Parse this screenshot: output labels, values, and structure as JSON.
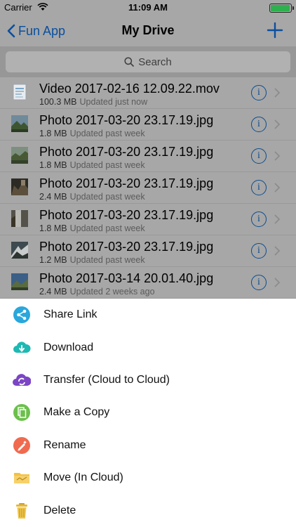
{
  "status_bar": {
    "carrier": "Carrier",
    "time": "11:09 AM",
    "battery_level": 0.95
  },
  "nav": {
    "back_label": "Fun App",
    "title": "My Drive"
  },
  "search": {
    "placeholder": "Search"
  },
  "files": [
    {
      "name": "Video 2017-02-16 12.09.22.mov",
      "size": "100.3 MB",
      "updated": "Updated just now",
      "type": "video"
    },
    {
      "name": "Photo 2017-03-20 23.17.19.jpg",
      "size": "1.8 MB",
      "updated": "Updated past week",
      "type": "photo"
    },
    {
      "name": "Photo 2017-03-20 23.17.19.jpg",
      "size": "1.8 MB",
      "updated": "Updated past week",
      "type": "photo"
    },
    {
      "name": "Photo 2017-03-20 23.17.19.jpg",
      "size": "2.4 MB",
      "updated": "Updated past week",
      "type": "photo"
    },
    {
      "name": "Photo 2017-03-20 23.17.19.jpg",
      "size": "1.8 MB",
      "updated": "Updated past week",
      "type": "photo"
    },
    {
      "name": "Photo 2017-03-20 23.17.19.jpg",
      "size": "1.2 MB",
      "updated": "Updated past week",
      "type": "photo"
    },
    {
      "name": "Photo 2017-03-14 20.01.40.jpg",
      "size": "2.4 MB",
      "updated": "Updated 2 weeks ago",
      "type": "photo"
    }
  ],
  "actions": [
    {
      "label": "Share Link",
      "icon": "share-icon",
      "color": "#2aa7dc"
    },
    {
      "label": "Download",
      "icon": "cloud-download-icon",
      "color": "#1db9b3"
    },
    {
      "label": "Transfer (Cloud to Cloud)",
      "icon": "cloud-transfer-icon",
      "color": "#7b45c4"
    },
    {
      "label": "Make a Copy",
      "icon": "copy-icon",
      "color": "#6bc04b"
    },
    {
      "label": "Rename",
      "icon": "rename-icon",
      "color": "#f06a4f"
    },
    {
      "label": "Move (In Cloud)",
      "icon": "folder-icon",
      "color": "#f2c242"
    },
    {
      "label": "Delete",
      "icon": "trash-icon",
      "color": "#e8b830"
    }
  ],
  "colors": {
    "tint": "#0a4f9f",
    "dim_background": "#a7a7a7"
  }
}
